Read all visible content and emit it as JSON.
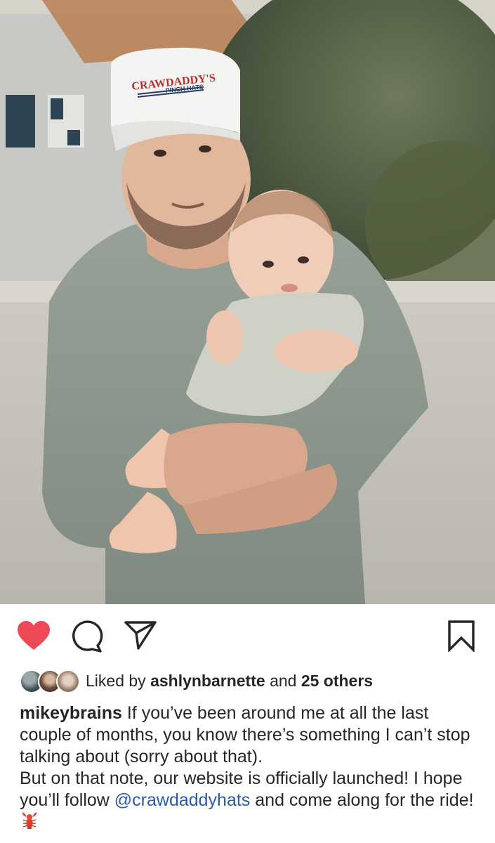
{
  "post": {
    "photo_alt": "Man in a white cap holding a baby outdoors",
    "hat": {
      "line1": "CRAWDADDY'S",
      "line2": "PINCH HATS"
    }
  },
  "actions": {
    "like_icon": "heart-icon",
    "comment_icon": "comment-icon",
    "share_icon": "share-icon",
    "save_icon": "bookmark-icon",
    "liked_color": "#ed4956"
  },
  "likes": {
    "prefix": "Liked by",
    "user": "ashlynbarnette",
    "connector": "and",
    "others": "25 others"
  },
  "caption": {
    "author": "mikeybrains",
    "line1_text": " If you’ve been around me at all the last couple of months, you know there’s something I can’t stop talking about (sorry about that).",
    "line2_start": "But on that note, our website is officially launched! I hope you’ll follow ",
    "mention": "@crawdaddyhats",
    "line2_end": " and come along for the ride! ",
    "emoji": "lobster"
  },
  "colors": {
    "text": "#262626",
    "mention": "#2b5aa8",
    "heart": "#ed4956"
  }
}
